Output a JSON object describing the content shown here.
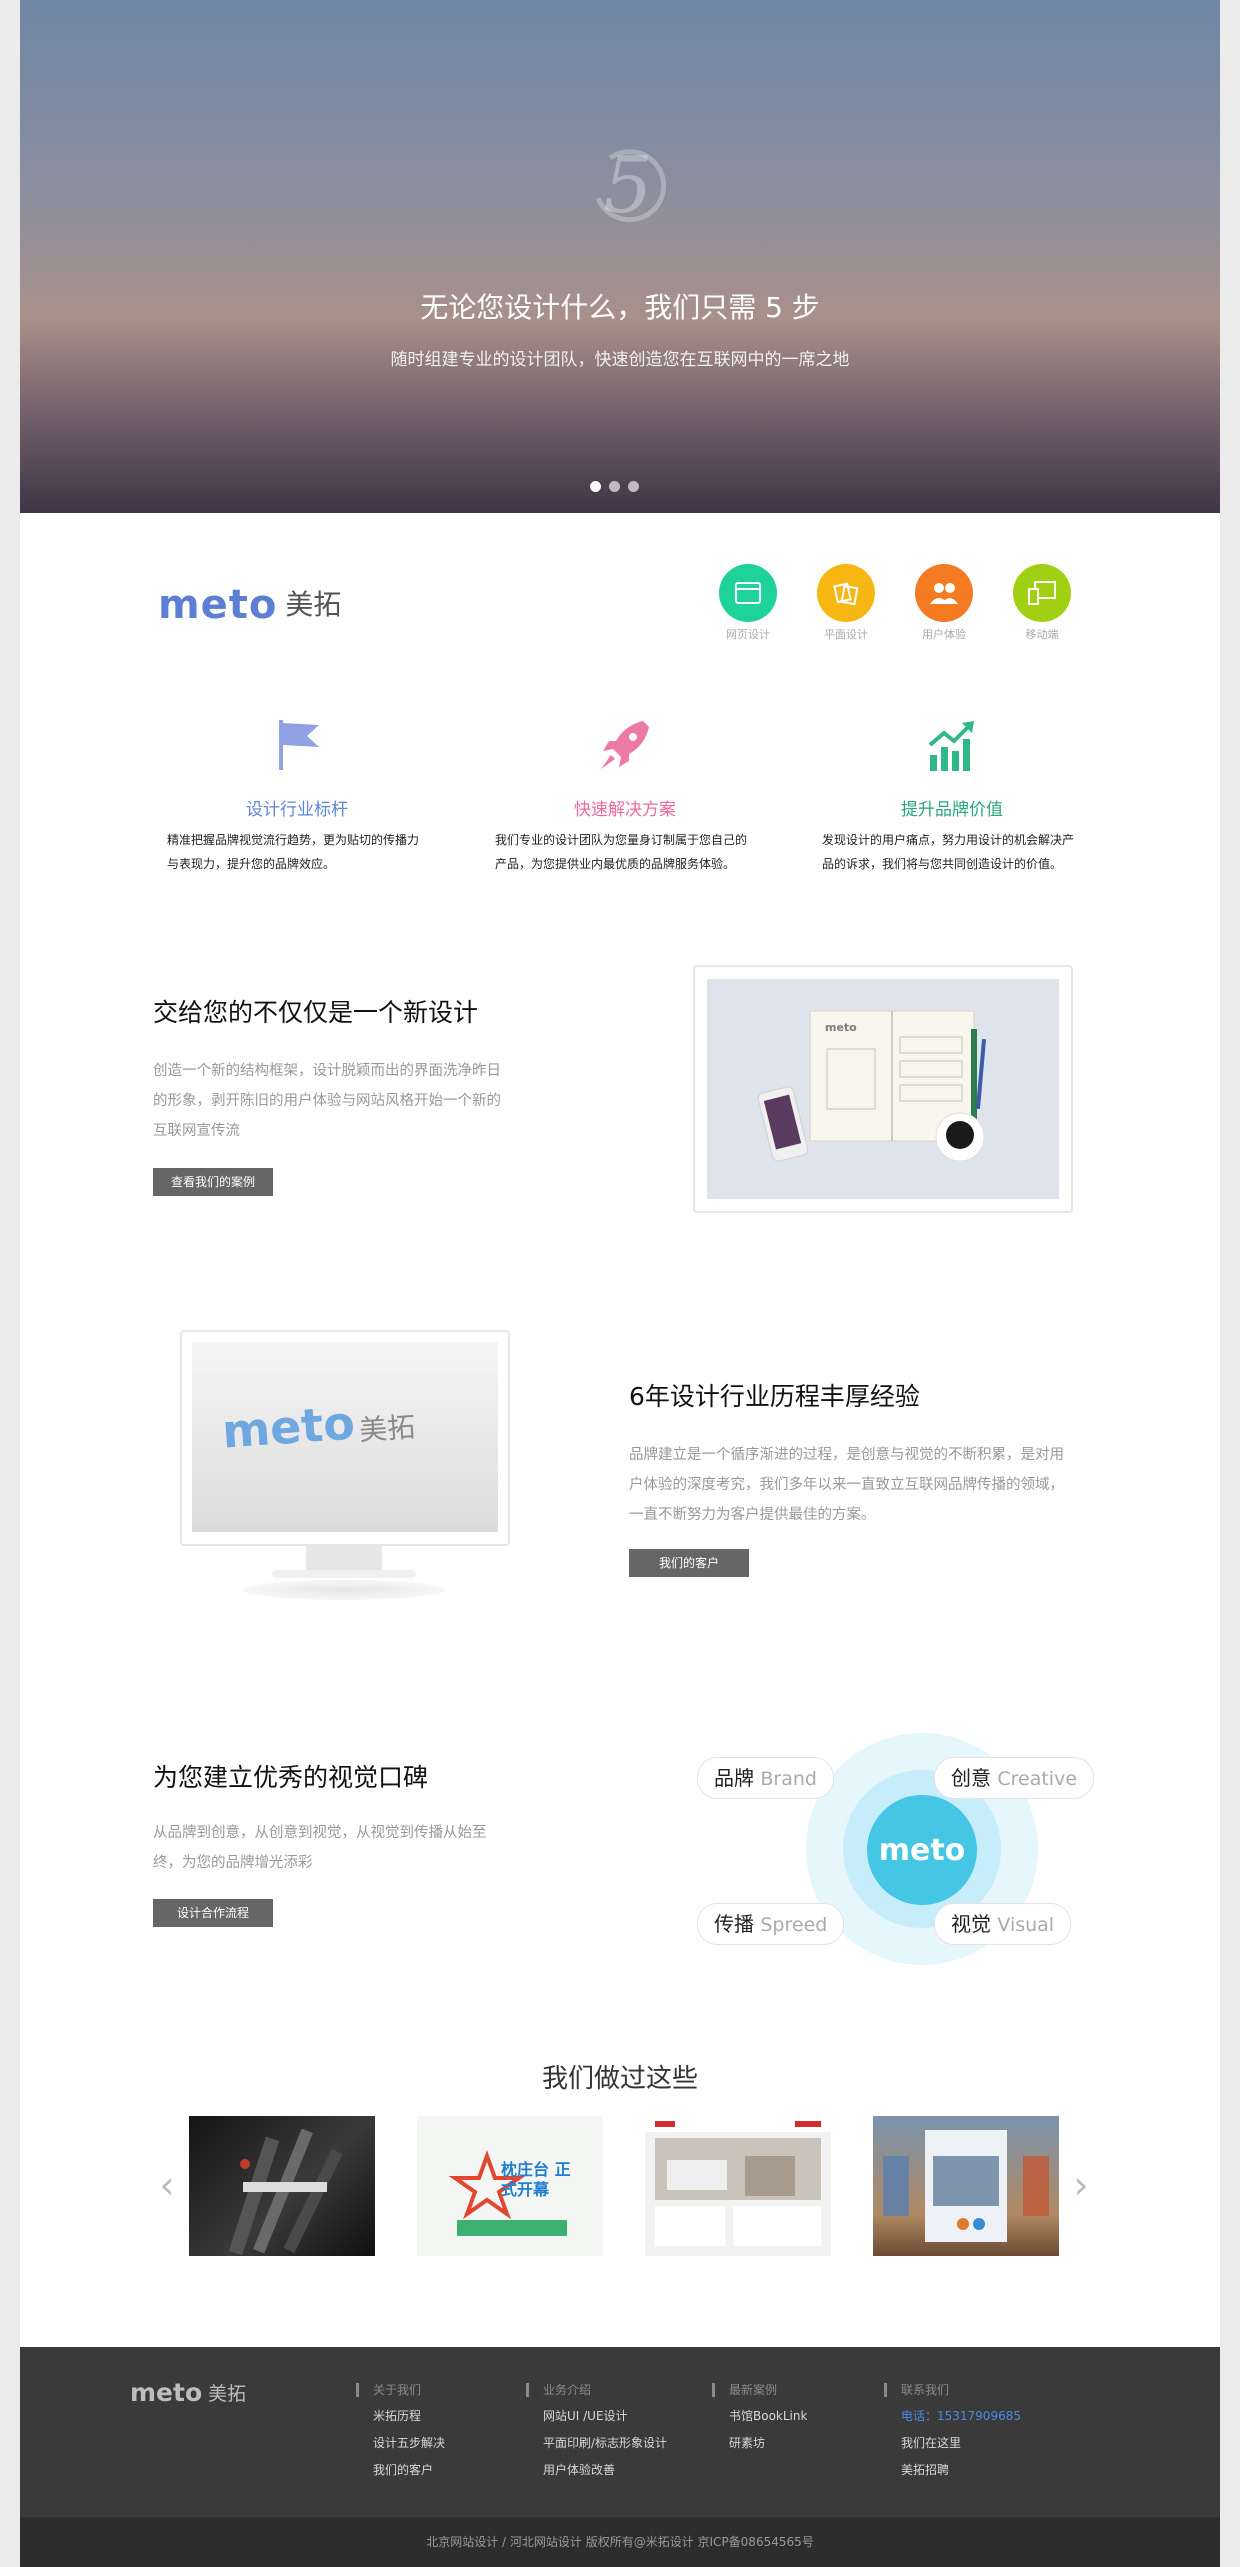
{
  "hero": {
    "badge": "5",
    "title": "无论您设计什么，我们只需 5 步",
    "subtitle": "随时组建专业的设计团队，快速创造您在互联网中的一席之地",
    "slide_count": 3,
    "active_slide": 1
  },
  "brand": {
    "logo_en": "meto",
    "logo_cn": "美拓"
  },
  "services": [
    {
      "label": "网页设计",
      "color": "#1ed39a",
      "icon": "browser-icon"
    },
    {
      "label": "平面设计",
      "color": "#f7b713",
      "icon": "documents-icon"
    },
    {
      "label": "用户体验",
      "color": "#f57b22",
      "icon": "users-icon"
    },
    {
      "label": "移动端",
      "color": "#a1cf12",
      "icon": "devices-icon"
    }
  ],
  "features": [
    {
      "title": "设计行业标杆",
      "desc": "精准把握品牌视觉流行趋势，更为贴切的传播力与表现力，提升您的品牌效应。",
      "color": "#8fa0e3",
      "title_color": "#5f86d8",
      "icon": "flag-icon"
    },
    {
      "title": "快速解决方案",
      "desc": "我们专业的设计团队为您量身订制属于您自己的产品，为您提供业内最优质的品牌服务体验。",
      "color": "#ec7aa5",
      "title_color": "#ec6b9b",
      "icon": "rocket-icon"
    },
    {
      "title": "提升品牌价值",
      "desc": "发现设计的用户痛点，努力用设计的机会解决产品的诉求，我们将与您共同创造设计的价值。",
      "color": "#2fb986",
      "title_color": "#29a57a",
      "icon": "growth-chart-icon"
    }
  ],
  "section1": {
    "title": "交给您的不仅仅是一个新设计",
    "body": "创造一个新的结构框架，设计脱颖而出的界面洗净昨日的形象，剥开陈旧的用户体验与网站风格开始一个新的互联网宣传流",
    "button": "查看我们的案例",
    "notebook_text": "meto"
  },
  "section2": {
    "title": "6年设计行业历程丰厚经验",
    "body": "品牌建立是一个循序渐进的过程，是创意与视觉的不断积累，是对用户体验的深度考究，我们多年以来一直致立互联网品牌传播的领域，一直不断努力为客户提供最佳的方案。",
    "button": "我们的客户",
    "screen_logo_en": "meto",
    "screen_logo_cn": "美拓"
  },
  "section3": {
    "title": "为您建立优秀的视觉口碑",
    "body": "从品牌到创意，从创意到视觉，从视觉到传播从始至终，为您的品牌增光添彩",
    "button": "设计合作流程",
    "core": "meto",
    "pills": [
      {
        "cn": "品牌",
        "en": "Brand"
      },
      {
        "cn": "创意",
        "en": "Creative"
      },
      {
        "cn": "传播",
        "en": "Spreed"
      },
      {
        "cn": "视觉",
        "en": "Visual"
      }
    ]
  },
  "works": {
    "title": "我们做过这些",
    "prev_icon": "chevron-left-icon",
    "next_icon": "chevron-right-icon",
    "item2_text": "枕庄台 正式开幕"
  },
  "footer": {
    "logo_en": "meto",
    "logo_cn": "美拓",
    "columns": [
      {
        "heading": "关于我们",
        "items": [
          "米拓历程",
          "设计五步解决",
          "我们的客户"
        ]
      },
      {
        "heading": "业务介绍",
        "items": [
          "网站UI /UE设计",
          "平面印刷/标志形象设计",
          "用户体验改善"
        ]
      },
      {
        "heading": "最新案例",
        "items": [
          "书馆BookLink",
          "研素坊"
        ]
      },
      {
        "heading": "联系我们",
        "items": [
          "电话：15317909685",
          "我们在这里",
          "美拓招聘"
        ]
      }
    ],
    "copyright": "北京网站设计 / 河北网站设计 版权所有@米拓设计 京ICP备08654565号"
  }
}
